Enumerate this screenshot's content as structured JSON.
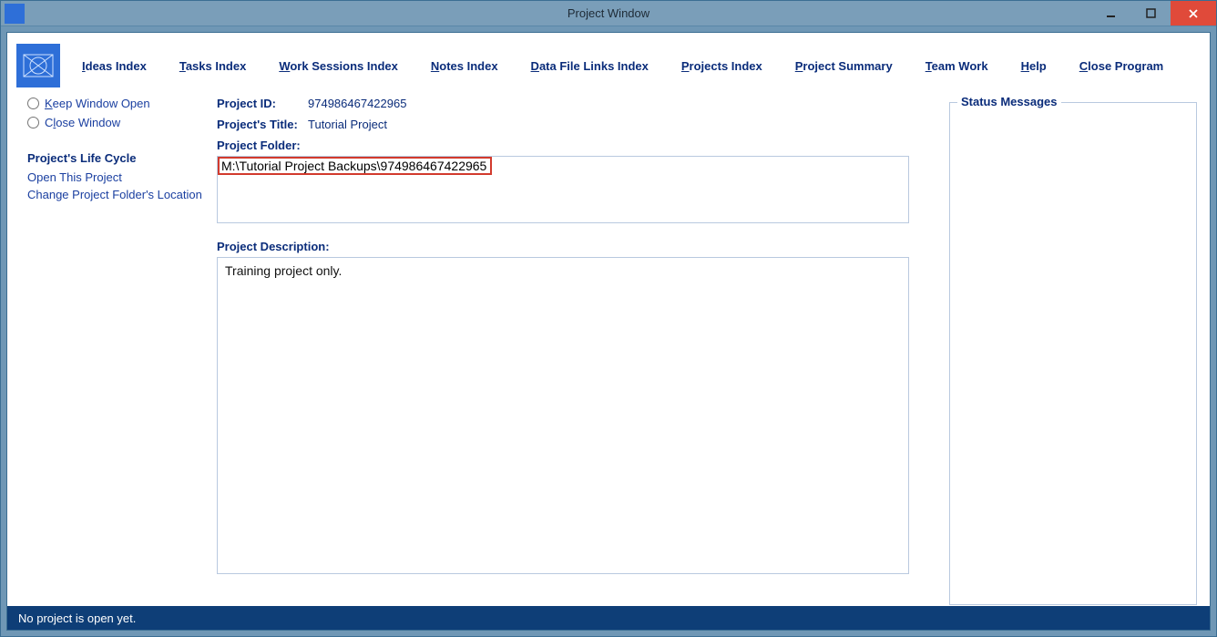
{
  "window": {
    "title": "Project Window"
  },
  "menu": {
    "ideas": {
      "pre": "I",
      "rest": "deas Index"
    },
    "tasks": {
      "pre": "T",
      "rest": "asks Index"
    },
    "work": {
      "pre": "W",
      "rest": "ork Sessions Index"
    },
    "notes": {
      "pre": "N",
      "rest": "otes Index"
    },
    "data": {
      "pre": "D",
      "rest": "ata File Links Index"
    },
    "projects": {
      "pre": "P",
      "rest": "rojects Index"
    },
    "summary": {
      "pre": "P",
      "rest": "roject Summary"
    },
    "team": {
      "pre": "T",
      "rest": "eam Work"
    },
    "help": {
      "pre": "H",
      "rest": "elp"
    },
    "close": {
      "pre": "C",
      "rest": "lose Program"
    }
  },
  "left": {
    "keep": {
      "pre": "K",
      "rest": "eep Window Open"
    },
    "closew": {
      "pre": "",
      "mid": "C",
      "midchar": "l",
      "rest": "ose Window",
      "full": "Close Window",
      "prefix": "C"
    },
    "lifecycle_head": "Project's Life Cycle",
    "open_project": "Open This Project",
    "change_folder": "Change Project Folder's Location"
  },
  "project": {
    "id_label": "Project ID:",
    "id_value": "974986467422965",
    "title_label": "Project's Title:",
    "title_value": "Tutorial Project",
    "folder_label": "Project Folder:",
    "folder_value": "M:\\Tutorial Project Backups\\974986467422965",
    "desc_label": "Project Description:",
    "desc_value": "Training project only."
  },
  "right": {
    "group_title": "Status Messages"
  },
  "status": {
    "text": "No project is open yet."
  },
  "colors": {
    "accent": "#0a2c7a",
    "titlebar": "#7a9eb9",
    "frame": "#6f97b5",
    "status": "#0e3e77",
    "close": "#e04a3a"
  }
}
